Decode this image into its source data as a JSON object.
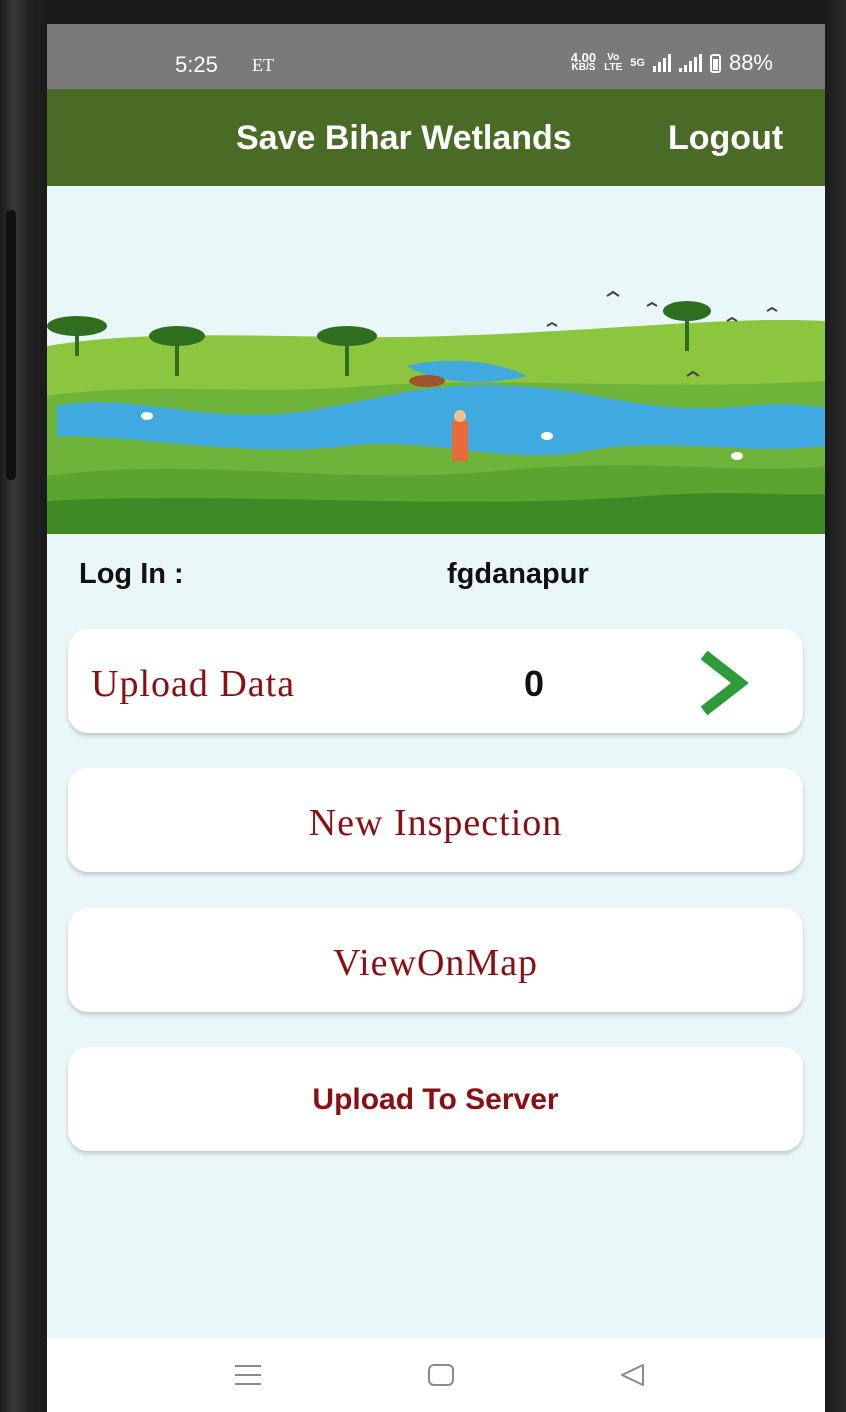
{
  "status_bar": {
    "time": "5:25",
    "carrier": "ET",
    "net_speed_value": "4.00",
    "net_speed_unit": "KB/S",
    "volte_top": "Vo",
    "volte_bottom": "LTE",
    "network": "5G",
    "battery": "88%"
  },
  "app_bar": {
    "title": "Save Bihar Wetlands",
    "logout_label": "Logout",
    "background_color": "#4a6b26"
  },
  "login": {
    "label": "Log In :",
    "username": "fgdanapur"
  },
  "upload_data": {
    "label": "Upload Data",
    "count": "0",
    "icon": "chevron-right-icon",
    "icon_color": "#2e9b3a"
  },
  "new_inspection": {
    "label": "New Inspection"
  },
  "view_on_map": {
    "label": "ViewOnMap"
  },
  "upload_to_server": {
    "label": "Upload To Server"
  },
  "nav_bar": {
    "icons": [
      "menu-icon",
      "home-icon",
      "back-icon"
    ]
  },
  "colors": {
    "label_red": "#8b0e13",
    "screen_background": "#eaf7f8",
    "status_gray": "#7a7a7a"
  }
}
